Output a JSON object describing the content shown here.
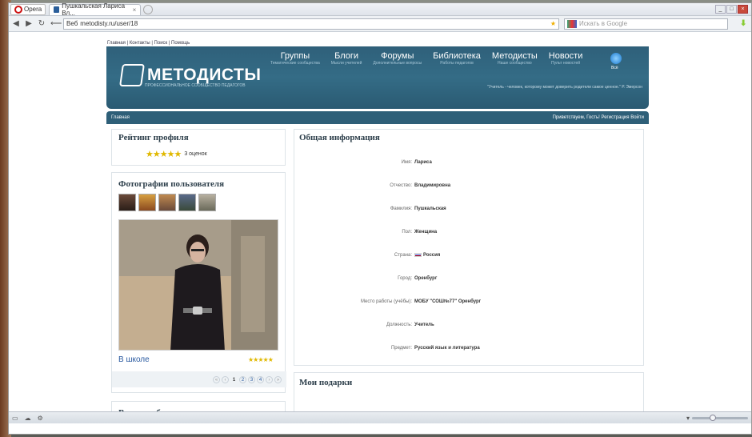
{
  "browser": {
    "menu_label": "Opera",
    "tab_title": "Пушкальская Лариса Вл...",
    "tab_close": "×",
    "address": "metodisty.ru/user/18",
    "address_prefix": "Веб",
    "search_placeholder": "Искать в Google",
    "back": "◀",
    "forward": "▶",
    "reload": "↻",
    "home": "⟵"
  },
  "site": {
    "topline": "Главная | Контакты | Поиск | Помощь",
    "logo_text": "МЕТОДИСТЫ",
    "logo_sub": "ПРОФЕССИОНАЛЬНОЕ СООБЩЕСТВО ПЕДАГОГОВ",
    "nav": [
      {
        "main": "Группы",
        "sub": "Тематические сообщества"
      },
      {
        "main": "Блоги",
        "sub": "Мысли учителей"
      },
      {
        "main": "Форумы",
        "sub": "Дополнительные вопросы"
      },
      {
        "main": "Библиотека",
        "sub": "Работы педагогов"
      },
      {
        "main": "Методисты",
        "sub": "Наше сообщество"
      },
      {
        "main": "Новости",
        "sub": "Пульт новостей"
      }
    ],
    "globe_label": "Всё",
    "quote": "\"Учитель - человек, которому может доверить родители самое ценное.\" Р. Эмерсон",
    "breadcrumb": "Главная",
    "greeting": "Приветствуем, Гость! Регистрация Войти"
  },
  "rating": {
    "title": "Рейтинг профиля",
    "stars": "★★★★★",
    "count": "3 оценок"
  },
  "photos": {
    "title": "Фотографии пользователя",
    "caption": "В школе",
    "stars": "★★★★★",
    "pager": [
      "«",
      "‹",
      "1",
      "2",
      "3",
      "4",
      "›",
      "»"
    ]
  },
  "video": {
    "title": "Видеоальбомы"
  },
  "info": {
    "title": "Общая информация",
    "rows": [
      {
        "label": "Имя:",
        "value": "Лариса"
      },
      {
        "label": "Отчество:",
        "value": "Владимировна"
      },
      {
        "label": "Фамилия:",
        "value": "Пушкальская"
      },
      {
        "label": "Пол:",
        "value": "Женщина"
      },
      {
        "label": "Страна:",
        "value": "Россия"
      },
      {
        "label": "Город:",
        "value": "Оренбург"
      },
      {
        "label": "Место работы (учёбы):",
        "value": "МОБУ \"СОШ№77\" Оренбург"
      },
      {
        "label": "Должность:",
        "value": "Учитель"
      },
      {
        "label": "Предмет:",
        "value": "Русский язык и литература"
      }
    ]
  },
  "gifts": {
    "title": "Мои подарки"
  },
  "colors": {
    "header": "#346c86",
    "stars": "#e0b800",
    "link": "#2a5aa0"
  }
}
